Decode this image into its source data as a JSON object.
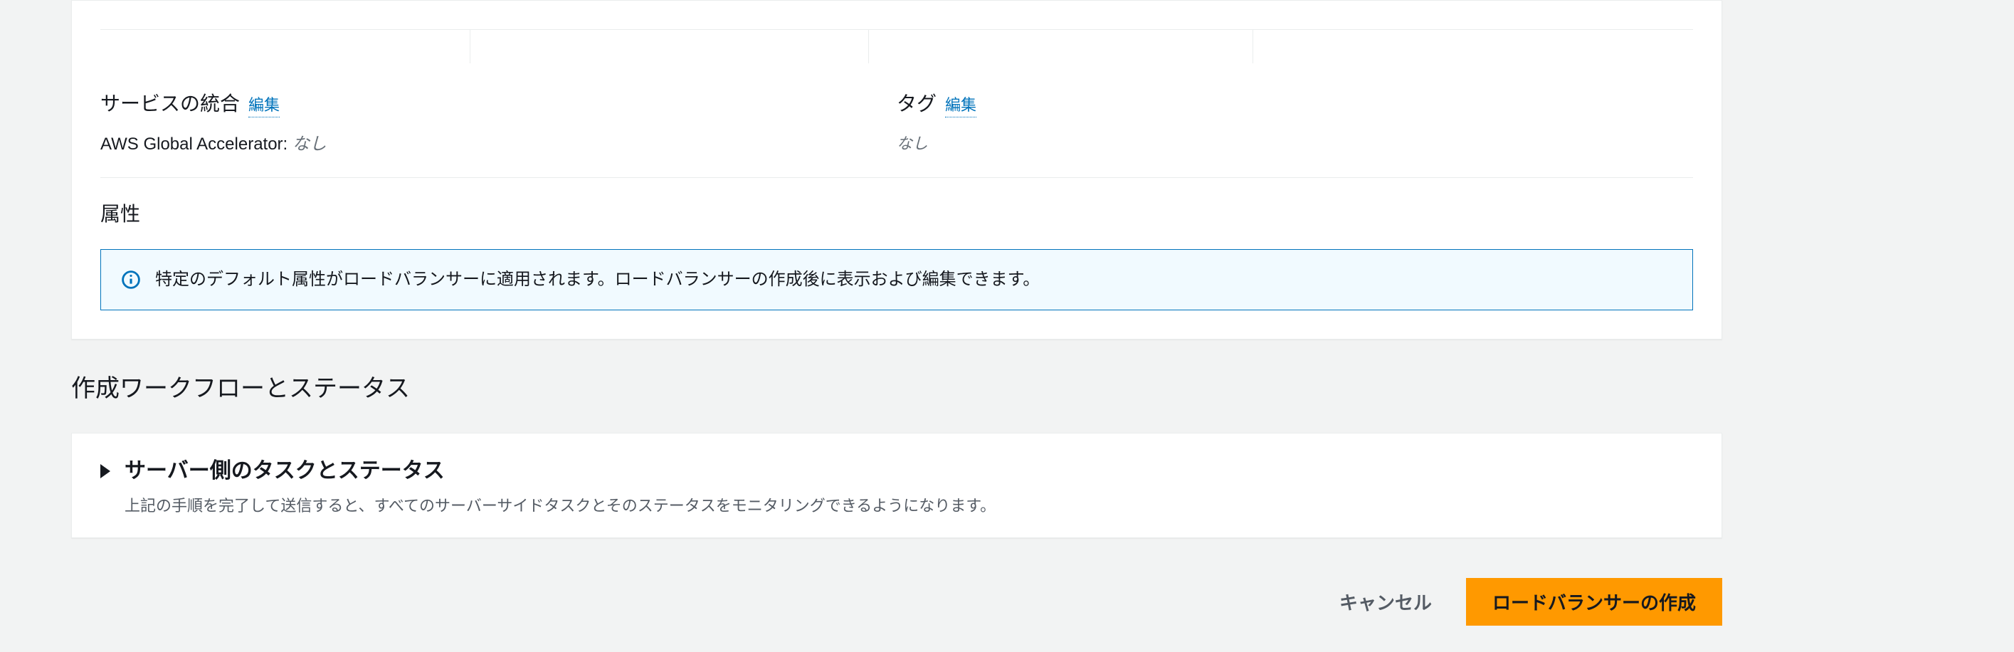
{
  "summary": {
    "service_integration": {
      "heading": "サービスの統合",
      "edit": "編集",
      "items": [
        {
          "key": "AWS Global Accelerator:",
          "value": "なし"
        }
      ]
    },
    "tags": {
      "heading": "タグ",
      "edit": "編集",
      "value": "なし"
    },
    "attributes": {
      "heading": "属性",
      "info": "特定のデフォルト属性がロードバランサーに適用されます。ロードバランサーの作成後に表示および編集できます。"
    }
  },
  "workflow": {
    "heading": "作成ワークフローとステータス",
    "expandable": {
      "title": "サーバー側のタスクとステータス",
      "description": "上記の手順を完了して送信すると、すべてのサーバーサイドタスクとそのステータスをモニタリングできるようになります。"
    }
  },
  "actions": {
    "cancel": "キャンセル",
    "create": "ロードバランサーの作成"
  }
}
